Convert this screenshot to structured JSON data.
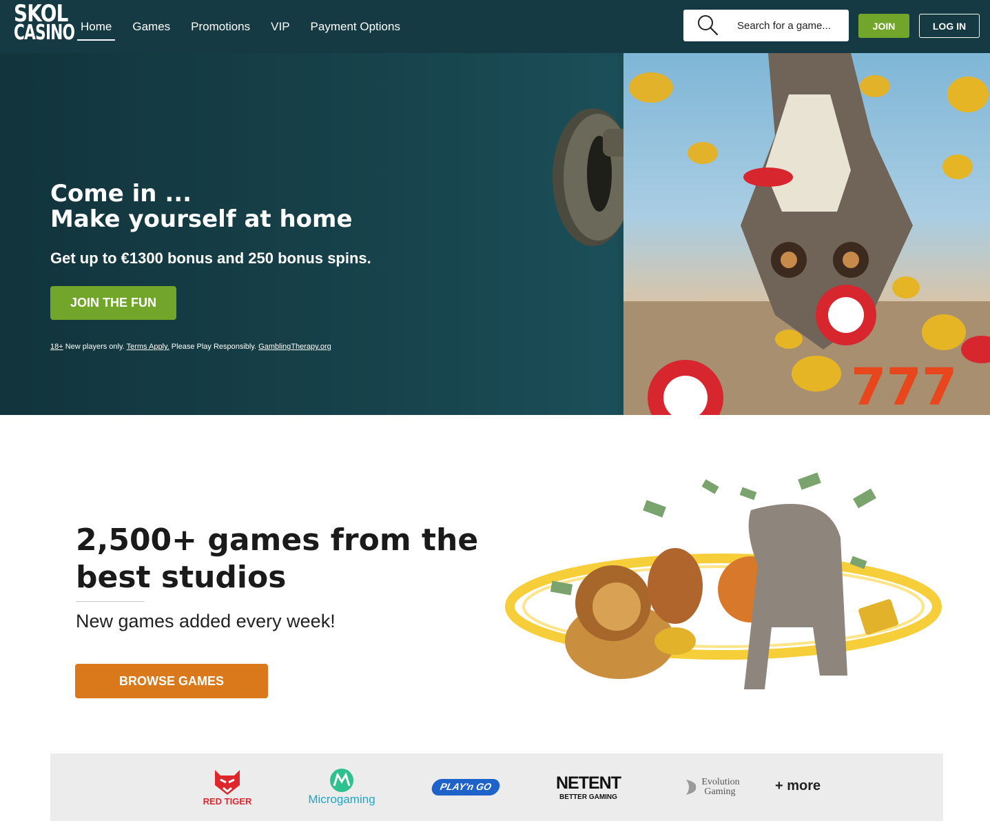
{
  "header": {
    "logo_line1": "SKOL",
    "logo_line2": "CASINO",
    "nav": [
      {
        "label": "Home",
        "active": true
      },
      {
        "label": "Games",
        "active": false
      },
      {
        "label": "Promotions",
        "active": false
      },
      {
        "label": "VIP",
        "active": false
      },
      {
        "label": "Payment Options",
        "active": false
      }
    ],
    "search_placeholder": "Search for a game...",
    "search_icon": "search-icon",
    "join_label": "JOIN",
    "login_label": "LOG IN"
  },
  "hero": {
    "title_line1": "Come in ...",
    "title_line2": "Make yourself at home",
    "subtitle": "Get up to €1300 bonus and 250 bonus spins.",
    "cta_label": "JOIN THE FUN",
    "terms": {
      "age": "18+",
      "text1": " New players only. ",
      "terms_link": "Terms Apply.",
      "text2": " Please Play Responsibly. ",
      "gt_link": "GamblingTherapy.org"
    }
  },
  "games": {
    "title_line1": "2,500+ games from the",
    "title_line2": "best studios",
    "subtitle": "New games added every week!",
    "cta_label": "BROWSE GAMES"
  },
  "providers": {
    "items": [
      {
        "name": "RED TIGER"
      },
      {
        "name": "Microgaming"
      },
      {
        "name": "PLAY'n GO"
      },
      {
        "name": "NETENT",
        "tagline": "BETTER GAMING"
      },
      {
        "name": "Evolution",
        "name2": "Gaming"
      }
    ],
    "more_label": "+ more"
  },
  "colors": {
    "header_bg": "#163a44",
    "join_green": "#72a62b",
    "browse_orange": "#d9791c",
    "providers_bg": "#ececec"
  }
}
